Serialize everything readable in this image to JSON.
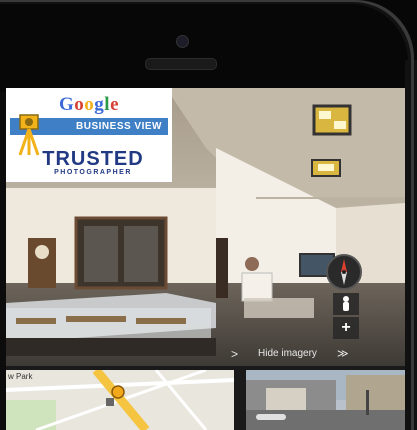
{
  "badge": {
    "brand": "Google",
    "brand_colors": [
      "#3b6ad8",
      "#d64135",
      "#f2b21a",
      "#3b6ad8",
      "#2c9a48",
      "#d64135"
    ],
    "product": "BUSINESS VIEW",
    "title": "TRUSTED",
    "subtitle": "PHOTOGRAPHER",
    "accent_color": "#3f7fc6",
    "text_color": "#223a84"
  },
  "viewer": {
    "hide_imagery_label": "Hide imagery",
    "next_label": ">",
    "collapse_label": "≫",
    "compass_icon": "compass-icon",
    "zoom_in_label": "+",
    "pegman_icon": "pegman-icon"
  },
  "map": {
    "place_label": "w Park"
  }
}
